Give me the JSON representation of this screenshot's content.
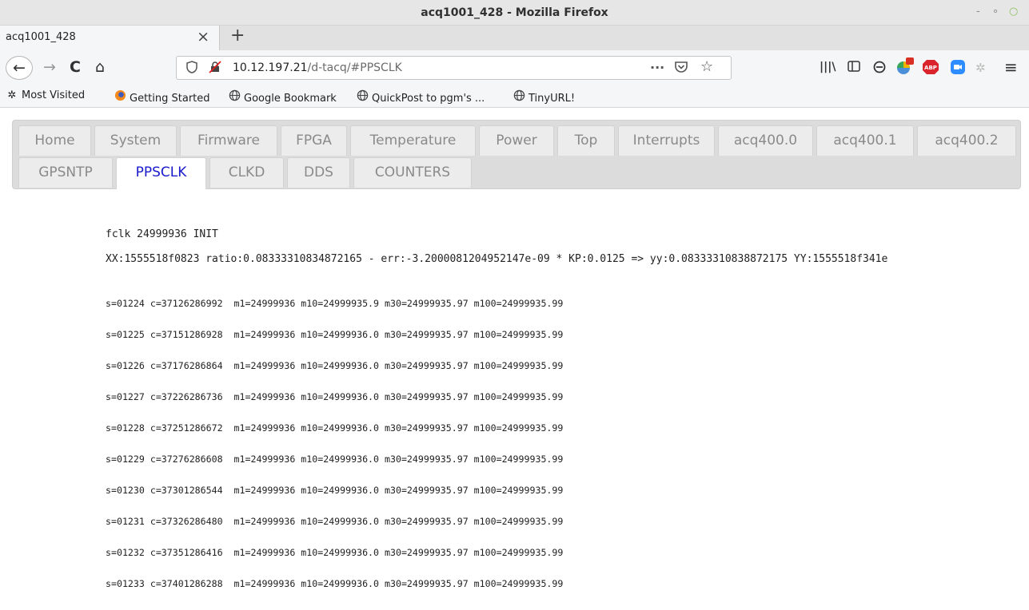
{
  "window": {
    "title": "acq1001_428 - Mozilla Firefox",
    "controls": [
      "-",
      "∘",
      "○"
    ]
  },
  "tab": {
    "label": "acq1001_428",
    "close": "×",
    "new": "+"
  },
  "nav": {
    "back": "←",
    "forward": "→",
    "reload": "C",
    "home": "⌂",
    "url_host": "10.12.197.21",
    "url_path": "/d-tacq/#PPSCLK",
    "menu_dots": "···",
    "hamburger": "≡"
  },
  "bookmarks": [
    {
      "label": "Most Visited",
      "icon": "gear-icon"
    },
    {
      "label": "Getting Started",
      "icon": "firefox-icon"
    },
    {
      "label": "Google Bookmark",
      "icon": "globe-icon"
    },
    {
      "label": "QuickPost to pgm's ...",
      "icon": "globe-icon"
    },
    {
      "label": "TinyURL!",
      "icon": "globe-icon"
    }
  ],
  "page_tabs_row1": [
    "Home",
    "System",
    "Firmware",
    "FPGA",
    "Temperature",
    "Power",
    "Top",
    "Interrupts",
    "acq400.0",
    "acq400.1",
    "acq400.2"
  ],
  "page_tabs_row2": [
    "GPSNTP",
    "PPSCLK",
    "CLKD",
    "DDS",
    "COUNTERS"
  ],
  "active_tab": "PPSCLK",
  "content": {
    "fclk": "fclk 24999936 INIT",
    "xx_line": "XX:1555518f0823 ratio:0.08333310834872165 - err:-3.2000081204952147e-09 * KP:0.0125 => yy:0.08333310838872175 YY:1555518f341e",
    "rows": [
      "s=01224 c=37126286992  m1=24999936 m10=24999935.9 m30=24999935.97 m100=24999935.99",
      "s=01225 c=37151286928  m1=24999936 m10=24999936.0 m30=24999935.97 m100=24999935.99",
      "s=01226 c=37176286864  m1=24999936 m10=24999936.0 m30=24999935.97 m100=24999935.99",
      "s=01227 c=37226286736  m1=24999936 m10=24999936.0 m30=24999935.97 m100=24999935.99",
      "s=01228 c=37251286672  m1=24999936 m10=24999936.0 m30=24999935.97 m100=24999935.99",
      "s=01229 c=37276286608  m1=24999936 m10=24999936.0 m30=24999935.97 m100=24999935.99",
      "s=01230 c=37301286544  m1=24999936 m10=24999936.0 m30=24999935.97 m100=24999935.99",
      "s=01231 c=37326286480  m1=24999936 m10=24999936.0 m30=24999935.97 m100=24999935.99",
      "s=01232 c=37351286416  m1=24999936 m10=24999936.0 m30=24999935.97 m100=24999935.99",
      "s=01233 c=37401286288  m1=24999936 m10=24999936.0 m30=24999935.97 m100=24999935.99"
    ]
  },
  "colors": {
    "active_tab_text": "#1a1acd",
    "inactive_tab_text": "#8a8a8a",
    "tab_panel_bg": "#dcdcdc"
  }
}
